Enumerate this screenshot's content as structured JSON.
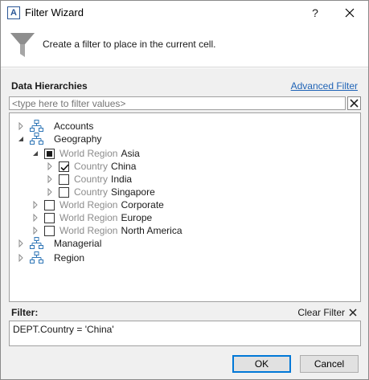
{
  "window": {
    "title": "Filter Wizard",
    "app_icon_letter": "A",
    "help_label": "?"
  },
  "header": {
    "instruction": "Create a filter to place in the current cell."
  },
  "hierarchies": {
    "section_label": "Data Hierarchies",
    "advanced_link": "Advanced Filter",
    "search_placeholder": "<type here to filter values>",
    "tree": [
      {
        "name": "Accounts"
      },
      {
        "name": "Geography"
      },
      {
        "level": "World Region",
        "member": "Asia"
      },
      {
        "level": "Country",
        "member": "China"
      },
      {
        "level": "Country",
        "member": "India"
      },
      {
        "level": "Country",
        "member": "Singapore"
      },
      {
        "level": "World Region",
        "member": "Corporate"
      },
      {
        "level": "World Region",
        "member": "Europe"
      },
      {
        "level": "World Region",
        "member": "North America"
      },
      {
        "name": "Managerial"
      },
      {
        "name": "Region"
      }
    ]
  },
  "filter": {
    "label": "Filter:",
    "clear_label": "Clear Filter",
    "expression": "DEPT.Country = 'China'"
  },
  "buttons": {
    "ok": "OK",
    "cancel": "Cancel"
  },
  "colors": {
    "accent": "#0078d7",
    "link": "#1f63b6",
    "icon_blue": "#2e75b6",
    "level_gray": "#8c8c8c",
    "panel_bg": "#f0f0f0"
  }
}
